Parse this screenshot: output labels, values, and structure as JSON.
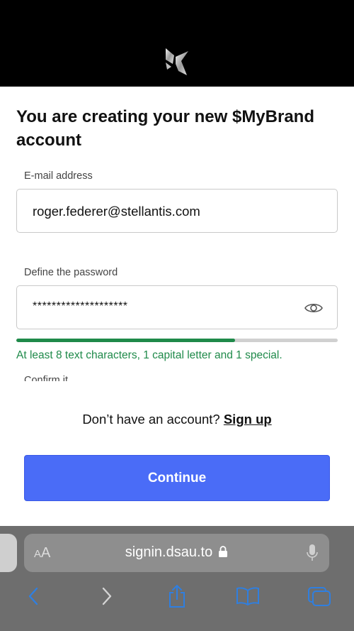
{
  "header": {
    "logo_icon": "ds-logo-icon",
    "background": "#000000"
  },
  "form": {
    "title": "You are creating your new $MyBrand account",
    "email": {
      "label": "E-mail address",
      "value": "roger.federer@stellantis.com"
    },
    "password": {
      "label": "Define the password",
      "value": "********************",
      "toggle_icon": "eye-icon",
      "strength": 0.68,
      "strength_color": "#1f8a4a",
      "hint": "At least 8 text characters, 1 capital letter and 1 special."
    },
    "confirm": {
      "label": "Confirm it"
    },
    "signup_prompt": "Don’t have an account?",
    "signup_link": "Sign up",
    "continue_label": "Continue",
    "accent_color": "#4a6cf7"
  },
  "browser": {
    "aa_large": "A",
    "aa_small": "A",
    "url": "signin.dsau.to",
    "icons": [
      "lock-icon",
      "microphone-icon",
      "back-icon",
      "forward-icon",
      "share-icon",
      "bookmarks-icon",
      "tabs-icon"
    ]
  }
}
